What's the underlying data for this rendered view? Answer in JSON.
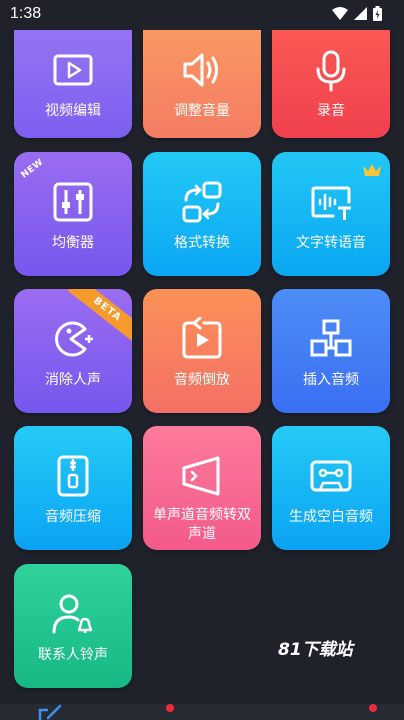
{
  "status": {
    "time": "1:38"
  },
  "tools": [
    {
      "label": "视频编辑",
      "icon": "video-play-icon",
      "color_top": "#9a76f2",
      "color_bottom": "#7d5ff0"
    },
    {
      "label": "调整音量",
      "icon": "speaker-volume-icon",
      "color_top": "#fb9c62",
      "color_bottom": "#f47c63"
    },
    {
      "label": "录音",
      "icon": "microphone-icon",
      "color_top": "#fb5c55",
      "color_bottom": "#f0404d"
    },
    {
      "label": "均衡器",
      "icon": "equalizer-icon",
      "color_top": "#9a6cf0",
      "color_bottom": "#7657ee",
      "badge": "NEW"
    },
    {
      "label": "格式转换",
      "icon": "format-convert-icon",
      "color_top": "#23c9f6",
      "color_bottom": "#0ba6f4"
    },
    {
      "label": "文字转语音",
      "icon": "text-to-speech-icon",
      "color_top": "#22c7f5",
      "color_bottom": "#0aa7f2",
      "badge_icon": "crown-icon"
    },
    {
      "label": "消除人声",
      "icon": "vocal-remove-icon",
      "color_top": "#9a6cf0",
      "color_bottom": "#7657ee",
      "ribbon": "BETA"
    },
    {
      "label": "音频倒放",
      "icon": "reverse-audio-icon",
      "color_top": "#fb9158",
      "color_bottom": "#f47065"
    },
    {
      "label": "插入音频",
      "icon": "insert-audio-icon",
      "color_top": "#4d8df6",
      "color_bottom": "#3a6ff3"
    },
    {
      "label": "音频压缩",
      "icon": "zip-compress-icon",
      "color_top": "#25cbf6",
      "color_bottom": "#0aa3f3"
    },
    {
      "label": "单声道音频转双声道",
      "icon": "mono-to-stereo-icon",
      "color_top": "#fc7b9a",
      "color_bottom": "#f35a8a"
    },
    {
      "label": "生成空白音频",
      "icon": "cassette-icon",
      "color_top": "#25cbf6",
      "color_bottom": "#0aa3f3"
    },
    {
      "label": "联系人铃声",
      "icon": "contact-ringtone-icon",
      "color_top": "#2ed29a",
      "color_bottom": "#16b884"
    }
  ],
  "watermark": "81下载站"
}
